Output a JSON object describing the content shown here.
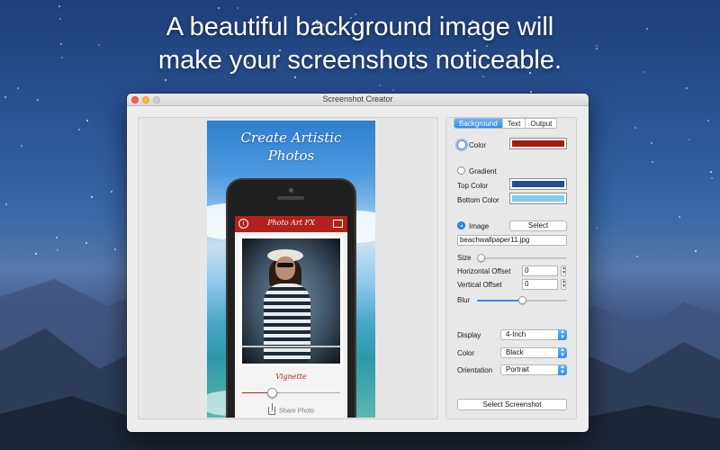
{
  "promo": {
    "line1": "A beautiful background image will",
    "line2": "make your screenshots noticeable."
  },
  "window": {
    "title": "Screenshot Creator"
  },
  "preview": {
    "headline_line1": "Create Artistic",
    "headline_line2": "Photos",
    "app_title": "Photo Art FX",
    "effect_label": "Vignette",
    "share_label": "Share Photo",
    "vignette_level": 0.3
  },
  "tabs": [
    {
      "label": "Background",
      "active": true
    },
    {
      "label": "Text",
      "active": false
    },
    {
      "label": "Output",
      "active": false
    }
  ],
  "background": {
    "color_label": "Color",
    "color_value": "#a51d12",
    "gradient_label": "Gradient",
    "top_color_label": "Top Color",
    "top_color_value": "#1e4f8e",
    "bottom_color_label": "Bottom Color",
    "bottom_color_value": "#7fcbf2",
    "image_label": "Image",
    "select_button": "Select",
    "image_file": "beachwallpaper11.jpg",
    "size_label": "Size",
    "size_value": 0.0,
    "h_offset_label": "Horizontal Offset",
    "h_offset_value": "0",
    "v_offset_label": "Vertical Offset",
    "v_offset_value": "0",
    "blur_label": "Blur",
    "blur_value": 0.5
  },
  "device": {
    "display_label": "Display",
    "display_value": "4-Inch",
    "color_label": "Color",
    "color_value": "Black",
    "orientation_label": "Orientation",
    "orientation_value": "Portrait"
  },
  "actions": {
    "select_screenshot": "Select Screenshot"
  },
  "theme": {
    "accent": "#2d8bf1",
    "app_red": "#b3221a"
  }
}
